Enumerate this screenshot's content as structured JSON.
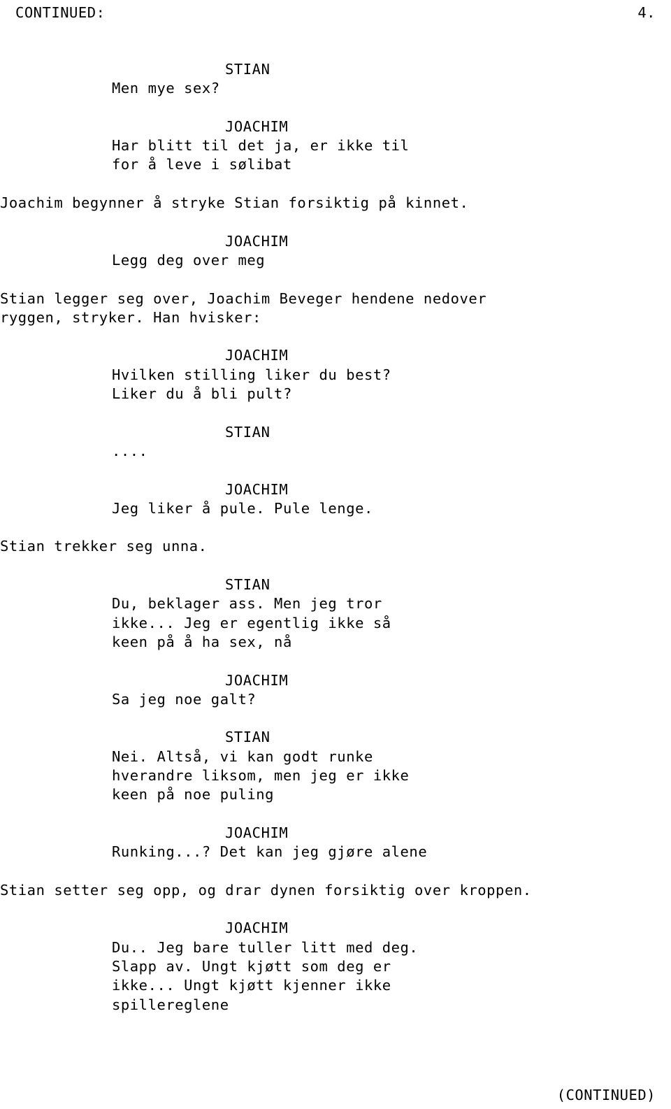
{
  "header": {
    "left": "CONTINUED:",
    "right": "4."
  },
  "footer": {
    "text": "(CONTINUED)"
  },
  "script": {
    "blocks": [
      {
        "type": "cue",
        "text": "STIAN"
      },
      {
        "type": "dialog",
        "text": "Men mye sex?"
      },
      {
        "type": "blank",
        "text": ""
      },
      {
        "type": "cue",
        "text": "JOACHIM"
      },
      {
        "type": "dialog",
        "text": "Har blitt til det ja, er ikke til"
      },
      {
        "type": "dialog",
        "text": "for å leve i sølibat"
      },
      {
        "type": "blank",
        "text": ""
      },
      {
        "type": "action",
        "text": "Joachim begynner å stryke Stian forsiktig på kinnet."
      },
      {
        "type": "blank",
        "text": ""
      },
      {
        "type": "cue",
        "text": "JOACHIM"
      },
      {
        "type": "dialog",
        "text": "Legg deg over meg"
      },
      {
        "type": "blank",
        "text": ""
      },
      {
        "type": "action",
        "text": "Stian legger seg over, Joachim Beveger hendene nedover"
      },
      {
        "type": "action",
        "text": "ryggen, stryker. Han hvisker:"
      },
      {
        "type": "blank",
        "text": ""
      },
      {
        "type": "cue",
        "text": "JOACHIM"
      },
      {
        "type": "dialog",
        "text": "Hvilken stilling liker du best?"
      },
      {
        "type": "dialog",
        "text": "Liker du å bli pult?"
      },
      {
        "type": "blank",
        "text": ""
      },
      {
        "type": "cue",
        "text": "STIAN"
      },
      {
        "type": "dialog",
        "text": "...."
      },
      {
        "type": "blank",
        "text": ""
      },
      {
        "type": "cue",
        "text": "JOACHIM"
      },
      {
        "type": "dialog",
        "text": "Jeg liker å pule. Pule lenge."
      },
      {
        "type": "blank",
        "text": ""
      },
      {
        "type": "action",
        "text": "Stian trekker seg unna."
      },
      {
        "type": "blank",
        "text": ""
      },
      {
        "type": "cue",
        "text": "STIAN"
      },
      {
        "type": "dialog",
        "text": "Du, beklager ass. Men jeg tror"
      },
      {
        "type": "dialog",
        "text": "ikke... Jeg er egentlig ikke så"
      },
      {
        "type": "dialog",
        "text": "keen på å ha sex, nå"
      },
      {
        "type": "blank",
        "text": ""
      },
      {
        "type": "cue",
        "text": "JOACHIM"
      },
      {
        "type": "dialog",
        "text": "Sa jeg noe galt?"
      },
      {
        "type": "blank",
        "text": ""
      },
      {
        "type": "cue",
        "text": "STIAN"
      },
      {
        "type": "dialog",
        "text": "Nei. Altså, vi kan godt runke"
      },
      {
        "type": "dialog",
        "text": "hverandre liksom, men jeg er ikke"
      },
      {
        "type": "dialog",
        "text": "keen på noe puling"
      },
      {
        "type": "blank",
        "text": ""
      },
      {
        "type": "cue",
        "text": "JOACHIM"
      },
      {
        "type": "dialog",
        "text": "Runking...? Det kan jeg gjøre alene"
      },
      {
        "type": "blank",
        "text": ""
      },
      {
        "type": "action",
        "text": "Stian setter seg opp, og drar dynen forsiktig over kroppen."
      },
      {
        "type": "blank",
        "text": ""
      },
      {
        "type": "cue",
        "text": "JOACHIM"
      },
      {
        "type": "dialog",
        "text": "Du.. Jeg bare tuller litt med deg."
      },
      {
        "type": "dialog",
        "text": "Slapp av. Ungt kjøtt som deg er"
      },
      {
        "type": "dialog",
        "text": "ikke... Ungt kjøtt kjenner ikke"
      },
      {
        "type": "dialog",
        "text": "spillereglene"
      }
    ]
  }
}
